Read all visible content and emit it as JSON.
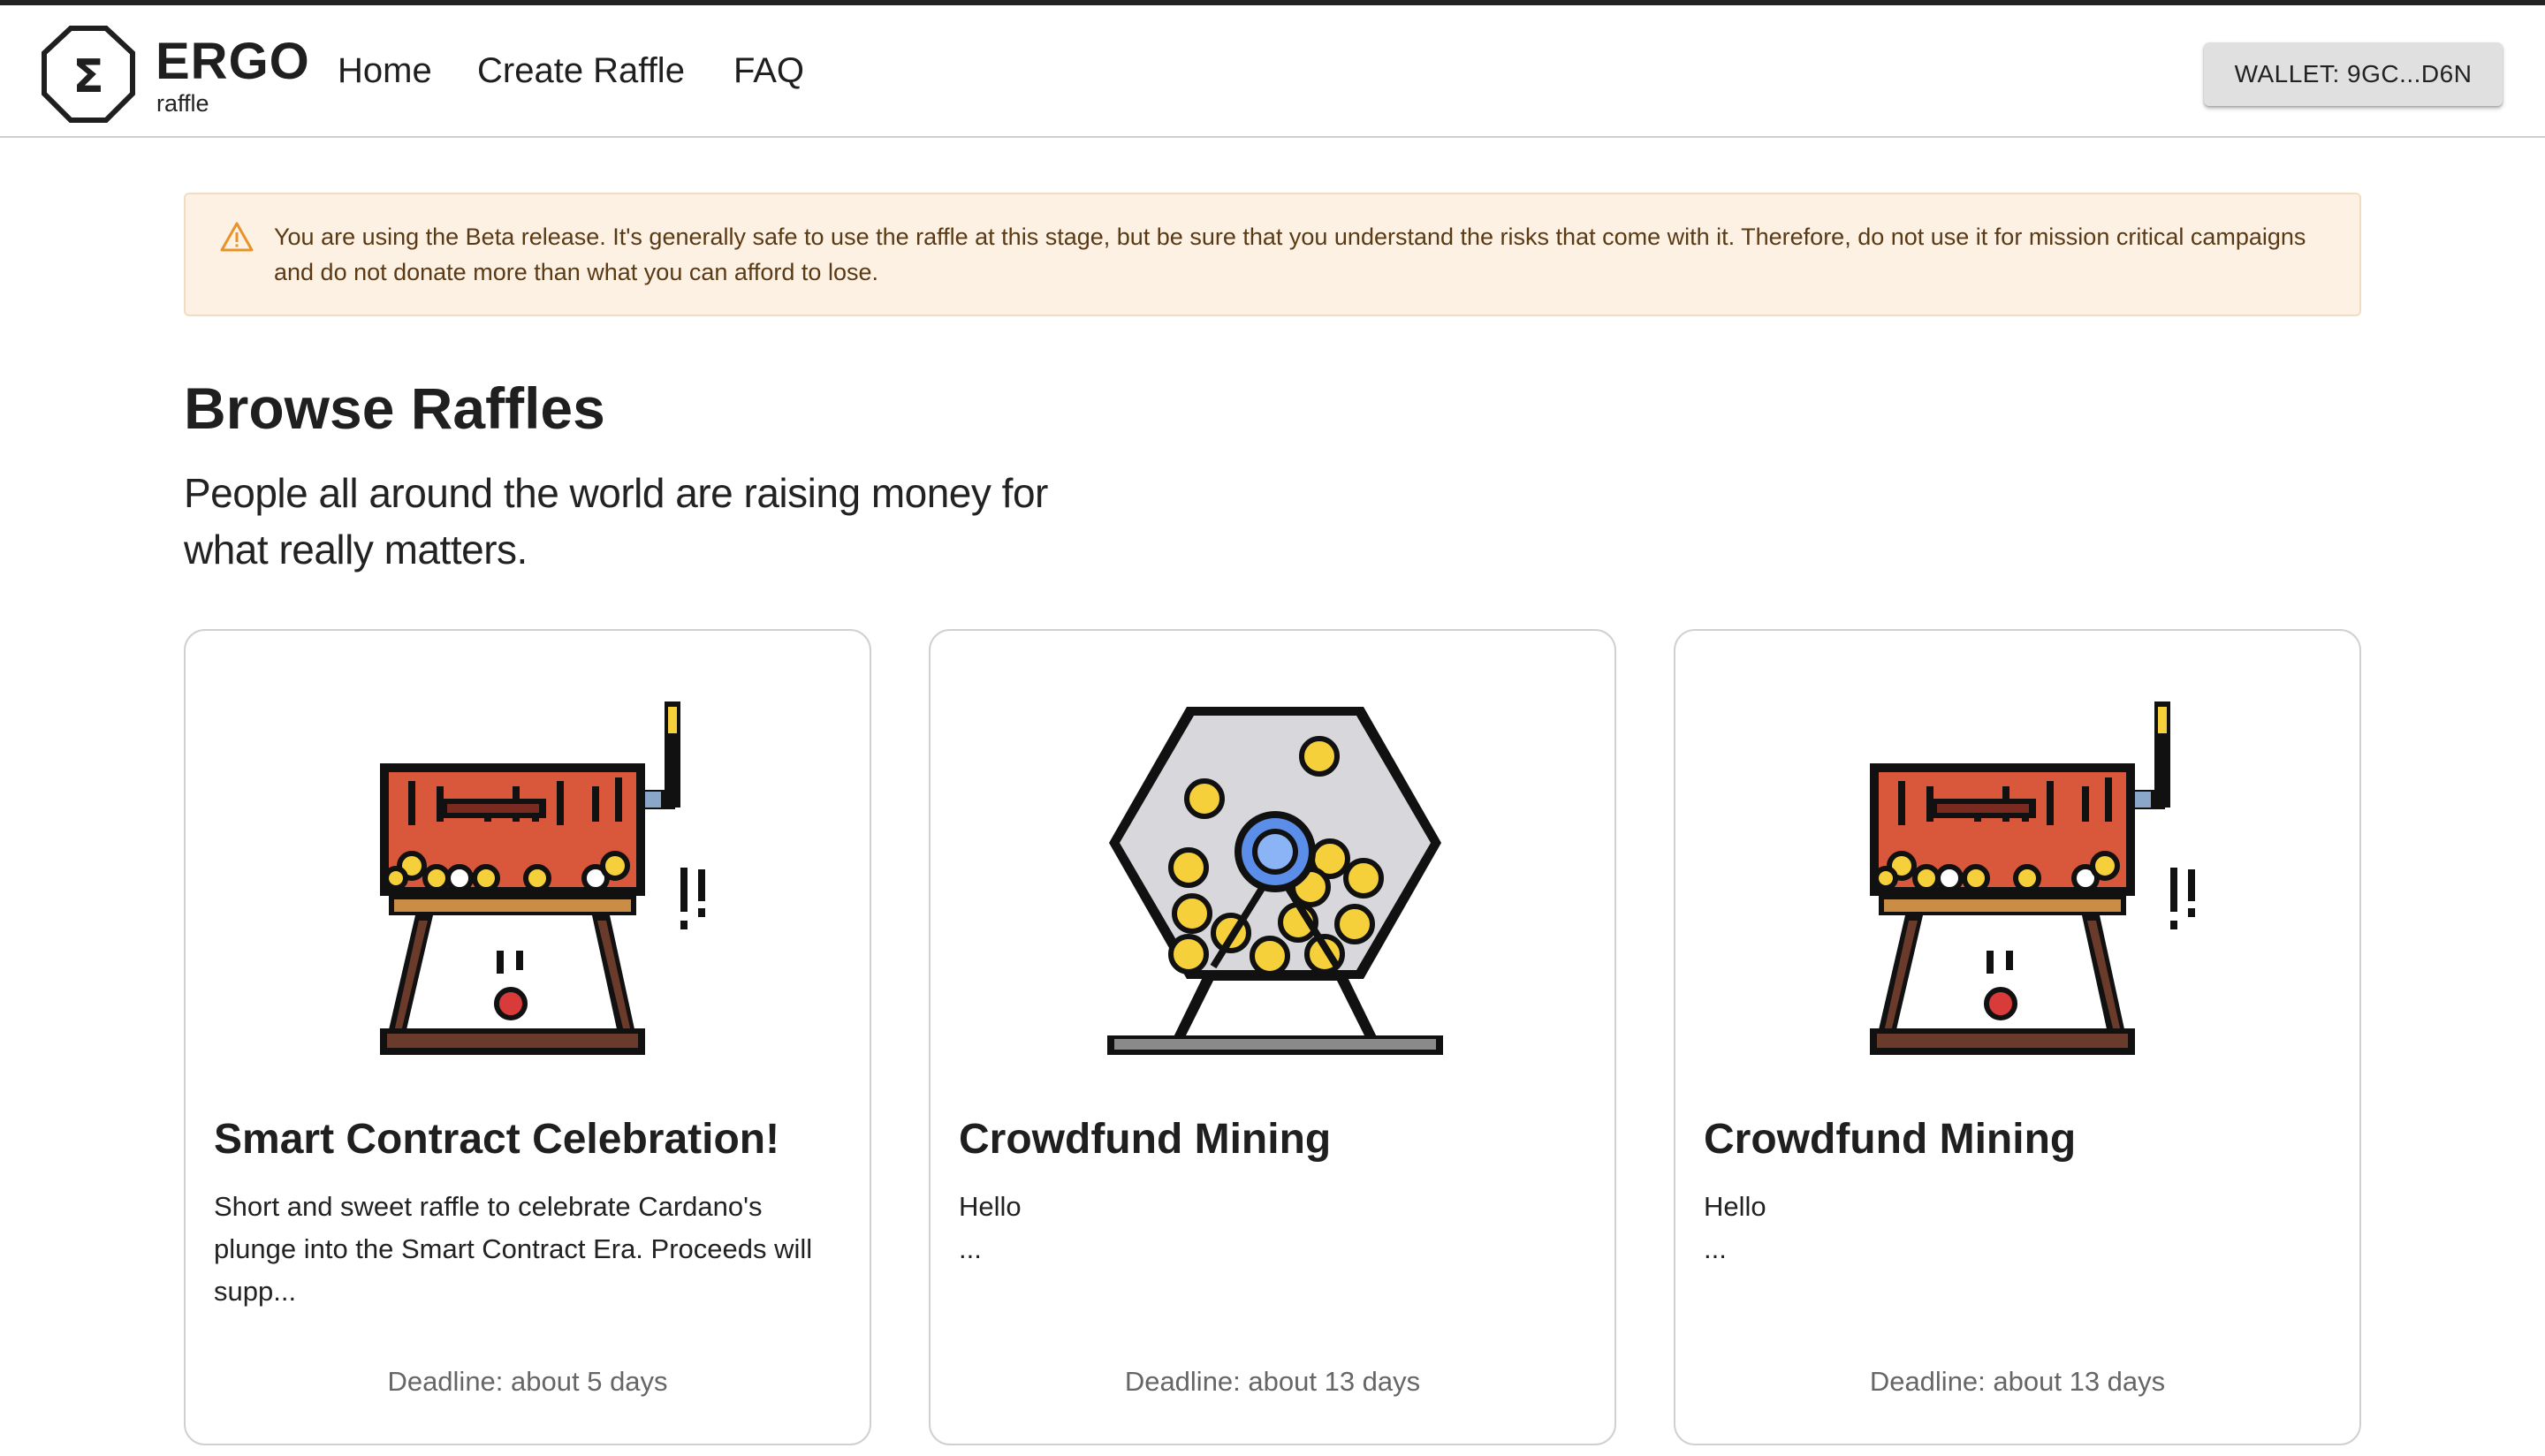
{
  "header": {
    "logo_symbol": "Σ",
    "logo_title": "ERGO",
    "logo_subtitle": "raffle",
    "nav": {
      "home": "Home",
      "create_raffle": "Create Raffle",
      "faq": "FAQ"
    },
    "wallet_label": "WALLET: 9GC...D6N"
  },
  "banner": {
    "icon": "warning-icon",
    "text": "You are using the Beta release. It's generally safe to use the raffle at this stage, but be sure that you understand the risks that come with it. Therefore, do not use it for mission critical campaigns and do not donate more than what you can afford to lose."
  },
  "main": {
    "title": "Browse Raffles",
    "subtitle": "People all around the world are raising money for what really matters."
  },
  "raffles": [
    {
      "image": "slot-machine-icon",
      "title": "Smart Contract Celebration!",
      "description": "Short and sweet raffle to celebrate Cardano's plunge into the Smart Contract Era. Proceeds will supp...",
      "deadline": "Deadline: about 5 days"
    },
    {
      "image": "lottery-drum-icon",
      "title": "Crowdfund Mining",
      "description": "Hello\n...",
      "deadline": "Deadline: about 13 days"
    },
    {
      "image": "slot-machine-icon",
      "title": "Crowdfund Mining",
      "description": "Hello\n...",
      "deadline": "Deadline: about 13 days"
    }
  ],
  "colors": {
    "banner_bg": "#fdf1e4",
    "banner_text": "#5a3a14",
    "warning_accent": "#e8922a",
    "machine_red": "#d9573a",
    "ball_yellow": "#f5d03a",
    "ball_blue": "#5b8ee8"
  }
}
